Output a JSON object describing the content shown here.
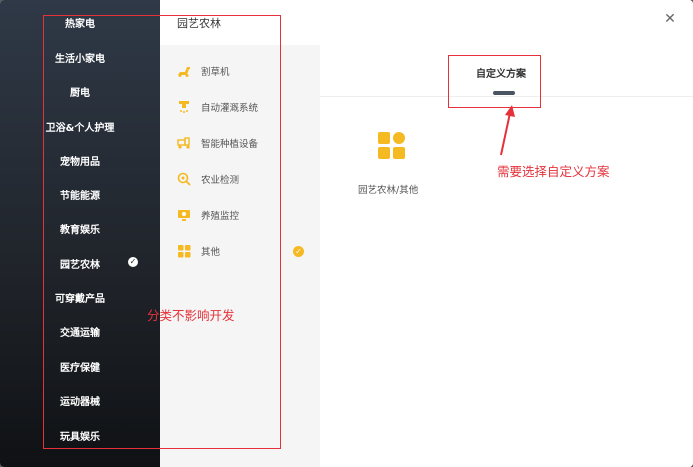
{
  "categories": [
    {
      "label": "热家电"
    },
    {
      "label": "生活小家电"
    },
    {
      "label": "厨电"
    },
    {
      "label": "卫浴&个人护理"
    },
    {
      "label": "宠物用品"
    },
    {
      "label": "节能能源"
    },
    {
      "label": "教育娱乐"
    },
    {
      "label": "园艺农林",
      "selected": true
    },
    {
      "label": "可穿戴产品"
    },
    {
      "label": "交通运输"
    },
    {
      "label": "医疗保健"
    },
    {
      "label": "运动器械"
    },
    {
      "label": "玩具娱乐"
    }
  ],
  "subcategory_panel": {
    "title": "园艺农林",
    "items": [
      {
        "label": "割草机",
        "icon": "lawnmower-icon"
      },
      {
        "label": "自动灌溉系统",
        "icon": "sprinkler-icon"
      },
      {
        "label": "智能种植设备",
        "icon": "tractor-icon"
      },
      {
        "label": "农业检测",
        "icon": "detection-icon"
      },
      {
        "label": "养殖监控",
        "icon": "monitor-icon"
      },
      {
        "label": "其他",
        "icon": "grid-icon",
        "selected": true
      }
    ]
  },
  "scheme_panel": {
    "tab_label": "自定义方案",
    "card_label": "园艺农林/其他"
  },
  "annotations": {
    "left_note": "分类不影响开发",
    "right_note": "需要选择自定义方案",
    "color": "#e5323a"
  },
  "colors": {
    "accent": "#f5b922",
    "nav_bg": "#1f2329"
  }
}
